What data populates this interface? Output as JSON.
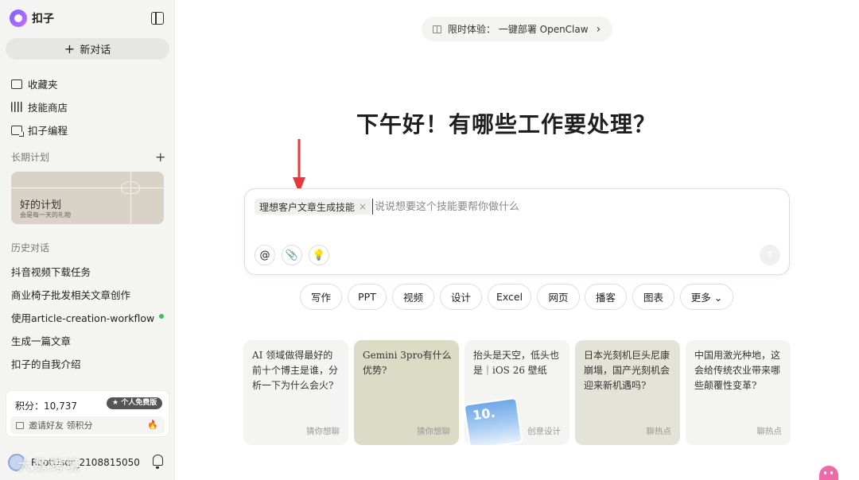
{
  "sidebar": {
    "brand": "扣子",
    "new_chat": "新对话",
    "nav": [
      "收藏夹",
      "技能商店",
      "扣子编程"
    ],
    "long_term_plan_title": "长期计划",
    "plan_card": {
      "title": "好的计划",
      "subtitle": "会是每一天的礼物"
    },
    "history_title": "历史对话",
    "history": [
      "抖音视频下载任务",
      "商业椅子批发相关文章创作",
      "使用article-creation-workflow生…",
      "生成一篇文章",
      "扣子的自我介绍"
    ],
    "points": "积分：10,737",
    "plan_badge": "★ 个人免费版",
    "invite": "邀请好友 领积分",
    "username": "RootUser_2108815050",
    "watermark": "大数跨境"
  },
  "main": {
    "promo": "限时体验：  一键部署 OpenClaw",
    "greeting": "下午好！有哪些工作要处理？",
    "skill_chip": "理想客户文章生成技能",
    "input_placeholder": "说说想要这个技能要帮你做什么",
    "tools": {
      "mention": "@",
      "attach": "📎",
      "idea": "💡",
      "send": "↑"
    },
    "pills": [
      "写作",
      "PPT",
      "视频",
      "设计",
      "Excel",
      "网页",
      "播客",
      "图表",
      "更多 ⌄"
    ],
    "cards": [
      {
        "text": "AI 领域做得最好的前十个博主是谁，分析一下为什么会火?",
        "tag": "猜你想聊",
        "bg": "#f4f4f2"
      },
      {
        "text": "Gemini 3pro有什么优势?",
        "tag": "猜你想聊",
        "bg": "#dcdbc6"
      },
      {
        "text": "抬头是天空，低头也是｜iOS 26 壁纸",
        "tag": "创意设计",
        "bg": "#f4f4f2"
      },
      {
        "text": "日本光刻机巨头尼康崩塌，国产光刻机会迎来新机遇吗?",
        "tag": "聊热点",
        "bg": "#e4e3d7"
      },
      {
        "text": "中国用激光种地，这会给传统农业带来哪些颠覆性变革?",
        "tag": "聊热点",
        "bg": "#f4f4f2"
      }
    ]
  },
  "colors": {
    "accent_red": "#e8383d",
    "online_green": "#31c45a"
  }
}
